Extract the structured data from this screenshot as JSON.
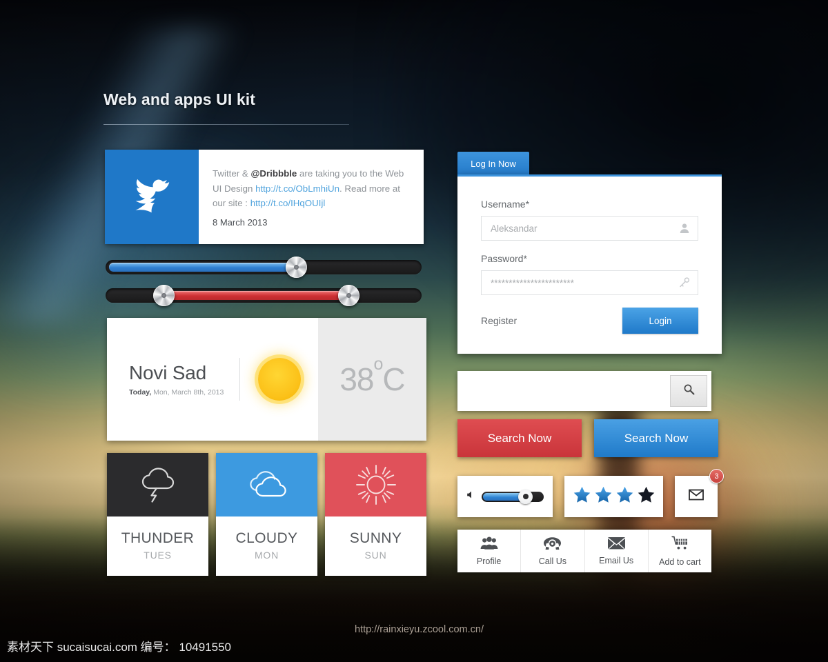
{
  "page": {
    "title": "Web and apps UI kit"
  },
  "twitter_card": {
    "logo_icon": "twitter-bird-icon",
    "brand_color": "#1f78c8",
    "text_prefix": "Twitter &",
    "mention": "@Dribbble",
    "text_mid1": " are taking you to the Web UI Design ",
    "link1": "http://t.co/ObLmhiUn",
    "text_mid2": ". Read more at our site : ",
    "link2": "http://t.co/IHqOUIjl",
    "date": "8 March 2013"
  },
  "sliders": [
    {
      "name": "blue-slider",
      "fill_color": "#2f7fd0",
      "value_pct": 59
    },
    {
      "name": "red-slider",
      "fill_color": "#cd2f32",
      "value_min_pct": 19,
      "value_max_pct": 79
    }
  ],
  "weather": {
    "city": "Novi Sad",
    "today_label": "Today,",
    "date": " Mon, March 8th, 2013",
    "icon": "sun-icon",
    "temperature": "38",
    "degree_symbol": "o",
    "unit": "C",
    "forecast": [
      {
        "icon": "thunder-cloud-icon",
        "tile_color": "#2b2b2d",
        "name": "THUNDER",
        "day": "TUES"
      },
      {
        "icon": "cloudy-icon",
        "tile_color": "#3d9ae0",
        "name": "CLOUDY",
        "day": "MON"
      },
      {
        "icon": "sun-rays-icon",
        "tile_color": "#e0515a",
        "name": "SUNNY",
        "day": "SUN"
      }
    ]
  },
  "login": {
    "tab_label": "Log In Now",
    "accent_color": "#3d94dd",
    "username_label": "Username*",
    "username_value": "Aleksandar",
    "username_placeholder": "Aleksandar",
    "username_icon": "user-icon",
    "password_label": "Password*",
    "password_value": "***********************",
    "password_icon": "key-icon",
    "register_label": "Register",
    "login_button": "Login"
  },
  "search": {
    "value": "",
    "placeholder": "",
    "go_icon": "search-icon",
    "buttons": [
      {
        "label": "Search Now",
        "color": "#c9343a",
        "style": "red"
      },
      {
        "label": "Search Now",
        "color": "#1f7ac9",
        "style": "blue"
      }
    ]
  },
  "widgets": {
    "volume": {
      "icon": "speaker-icon",
      "value_pct": 62
    },
    "rating": {
      "icon": "star-icon",
      "filled": 3,
      "total": 4,
      "filled_color": "#1f7ac9",
      "empty_color": "#141822"
    },
    "mail": {
      "icon": "envelope-icon",
      "badge_count": "3",
      "badge_color": "#c9433e"
    }
  },
  "actions": [
    {
      "icon": "people-icon",
      "label": "Profile"
    },
    {
      "icon": "phone-icon",
      "label": "Call Us"
    },
    {
      "icon": "envelope-icon",
      "label": "Email Us"
    },
    {
      "icon": "cart-icon",
      "label": "Add to cart"
    }
  ],
  "watermarks": {
    "url": "http://rainxieyu.zcool.com.cn/",
    "footer": "素材天下 sucaisucai.com  编号： 10491550"
  }
}
